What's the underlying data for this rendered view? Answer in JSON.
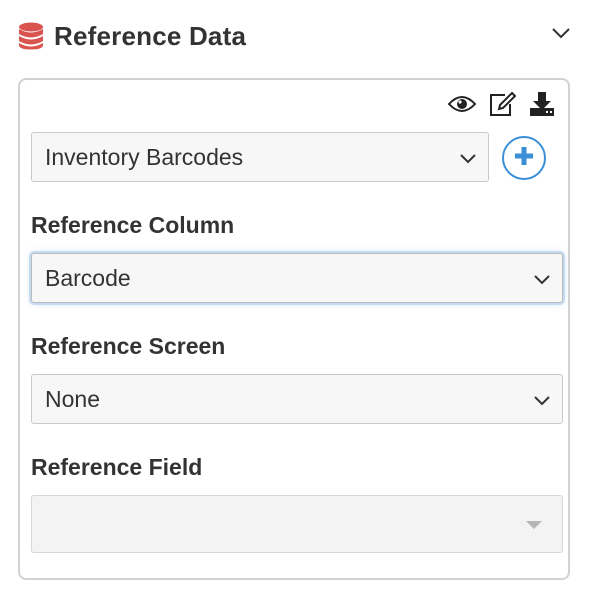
{
  "header": {
    "title": "Reference Data",
    "icon": "database-icon",
    "icon_color": "#d9534f",
    "collapse_icon": "chevron-down-icon"
  },
  "toolbar": {
    "icons": [
      "eye-icon",
      "edit-icon",
      "download-icon"
    ]
  },
  "table_select": {
    "value": "Inventory Barcodes"
  },
  "add_button": {
    "icon": "plus-icon",
    "color": "#3b8fd8"
  },
  "reference_column": {
    "label": "Reference Column",
    "value": "Barcode"
  },
  "reference_screen": {
    "label": "Reference Screen",
    "value": "None"
  },
  "reference_field": {
    "label": "Reference Field",
    "value": ""
  }
}
